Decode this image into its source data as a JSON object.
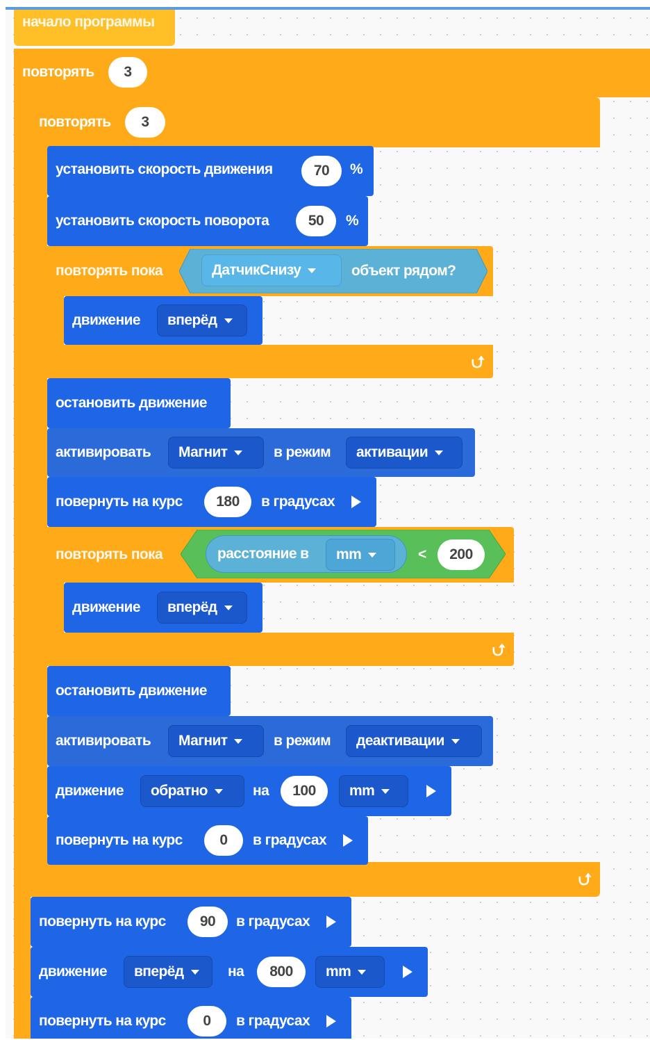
{
  "start_block": {
    "label": "начало программы"
  },
  "outer_repeat": {
    "label": "повторять",
    "count": "3"
  },
  "inner_repeat": {
    "label": "повторять",
    "count": "3"
  },
  "set_speed": {
    "label": "установить скорость движения",
    "value": "70",
    "unit": "%"
  },
  "set_turn_speed": {
    "label": "установить скорость поворота",
    "value": "50",
    "unit": "%"
  },
  "repeat_until_1": {
    "label": "повторять пока",
    "sensor": "ДатчикСнизу",
    "condition": "объект рядом?",
    "body": {
      "label": "движение",
      "direction": "вперёд"
    },
    "loop_icon": "loop-arrow-icon"
  },
  "stop_1": {
    "label": "остановить движение"
  },
  "activate_1": {
    "label": "активировать",
    "device": "Магнит",
    "mode_label": "в режим",
    "mode": "активации"
  },
  "turn_1": {
    "label": "повернуть на курс",
    "value": "180",
    "unit": "в градусах"
  },
  "repeat_until_2": {
    "label": "повторять пока",
    "sensor_label": "расстояние в",
    "sensor_unit": "mm",
    "operator": "<",
    "value": "200",
    "body": {
      "label": "движение",
      "direction": "вперёд"
    },
    "loop_icon": "loop-arrow-icon"
  },
  "stop_2": {
    "label": "остановить движение"
  },
  "activate_2": {
    "label": "активировать",
    "device": "Магнит",
    "mode_label": "в режим",
    "mode": "деактивации"
  },
  "move_back": {
    "label": "движение",
    "direction": "обратно",
    "on_label": "на",
    "value": "100",
    "unit": "mm"
  },
  "turn_2": {
    "label": "повернуть на курс",
    "value": "0",
    "unit": "в градусах"
  },
  "inner_loop_icon": "loop-arrow-icon",
  "turn_3": {
    "label": "повернуть на курс",
    "value": "90",
    "unit": "в градусах"
  },
  "move_fwd": {
    "label": "движение",
    "direction": "вперёд",
    "on_label": "на",
    "value": "800",
    "unit": "mm"
  },
  "turn_4": {
    "label": "повернуть на курс",
    "value": "0",
    "unit": "в градусах"
  },
  "colors": {
    "control": "#ffab19",
    "motion": "#1f66e6",
    "sensor": "#5cb1d6",
    "operator": "#59c059",
    "grid_dot": "#cfcfcf"
  }
}
